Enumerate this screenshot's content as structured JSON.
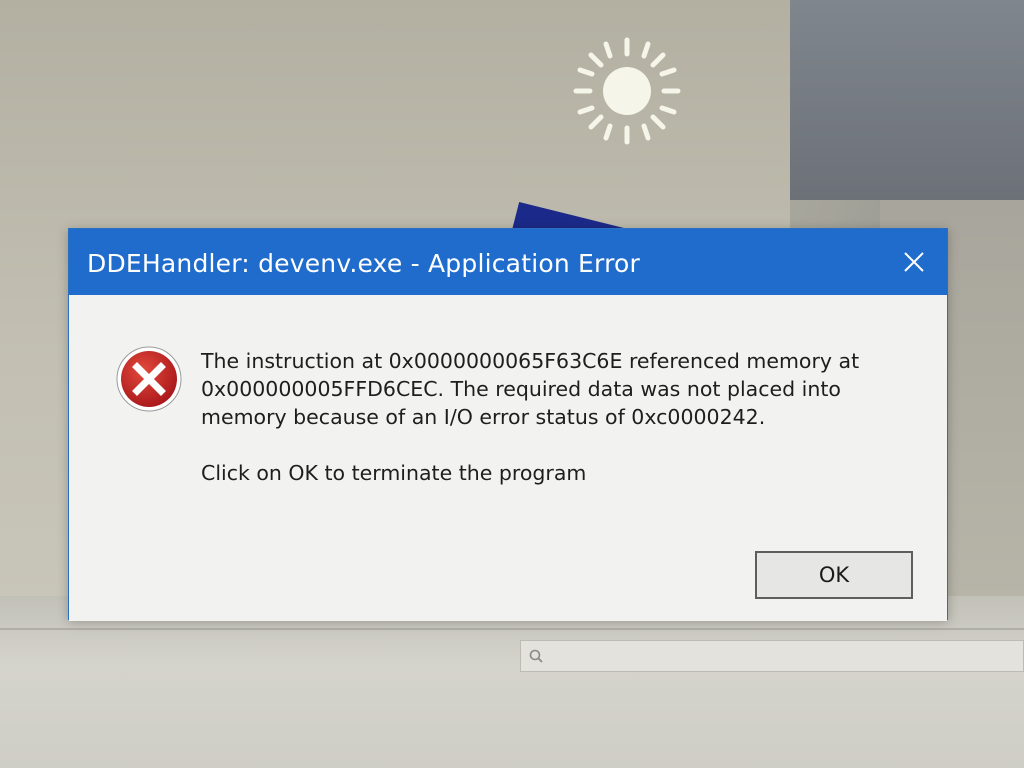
{
  "dialog": {
    "title": "DDEHandler: devenv.exe - Application Error",
    "close_icon": "close-icon",
    "error_icon": "error-x-icon",
    "message_line1": "The instruction at 0x0000000065F63C6E referenced memory at",
    "message_line2": "0x000000005FFD6CEC. The required data was not placed into",
    "message_line3": "memory because of an I/O error status of 0xc0000242.",
    "instruction": "Click on OK to terminate the program",
    "ok_label": "OK"
  },
  "colors": {
    "titlebar": "#1f6ccc",
    "error_red": "#c42222",
    "dialog_bg": "#f2f2f0"
  }
}
